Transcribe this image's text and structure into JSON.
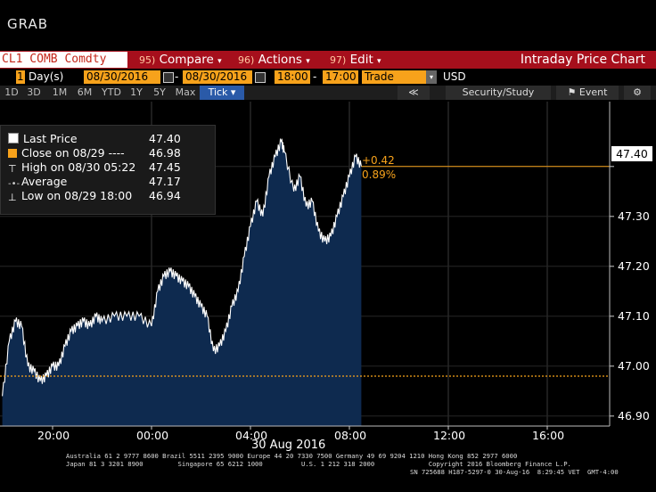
{
  "header": {
    "title": "GRAB"
  },
  "toolbar": {
    "ticker": "CL1 COMB Comdty",
    "buttons": [
      {
        "num": "95)",
        "label": "Compare",
        "arrow": "▾"
      },
      {
        "num": "96)",
        "label": "Actions",
        "arrow": "▾"
      },
      {
        "num": "97)",
        "label": "Edit",
        "arrow": "▾"
      }
    ],
    "chart_title": "Intraday Price Chart"
  },
  "range": {
    "days": "1",
    "days_unit": "Day(s)",
    "start_date": "08/30/2016",
    "dash": "-",
    "end_date": "08/30/2016",
    "start_time": "18:00",
    "end_time": "17:00",
    "field": "Trade",
    "currency": "USD"
  },
  "periods": [
    "1D",
    "3D",
    "1M",
    "6M",
    "YTD",
    "1Y",
    "5Y",
    "Max"
  ],
  "selected_period": "Tick ▾",
  "controls": {
    "back": "≪",
    "security": "Security/Study",
    "event": "Event",
    "settings_icon": "gear-icon"
  },
  "legend": [
    {
      "icon": "white-square",
      "label": "Last Price",
      "value": "47.40"
    },
    {
      "icon": "orange-square",
      "label": "Close on 08/29 ----",
      "value": "46.98"
    },
    {
      "icon": "high-marker",
      "label": "High on 08/30 05:22",
      "value": "47.45"
    },
    {
      "icon": "average-marker",
      "label": "Average",
      "value": "47.17"
    },
    {
      "icon": "low-marker",
      "label": "Low on 08/29 18:00",
      "value": "46.94"
    }
  ],
  "change": {
    "abs": "+0.42",
    "pct": "0.89%"
  },
  "last_price_label": "47.40",
  "date_label": "30 Aug 2016",
  "footer": {
    "line1": "Australia 61 2 9777 8600 Brazil 5511 2395 9000 Europe 44 20 7330 7500 Germany 49 69 9204 1210 Hong Kong 852 2977 6000",
    "line2": "Japan 81 3 3201 8900         Singapore 65 6212 1000          U.S. 1 212 318 2000              Copyright 2016 Bloomberg Finance L.P.",
    "line3": "SN 725688 H187-5297-0 30-Aug-16  8:29:45 VET  GMT-4:00"
  },
  "colors": {
    "toolbar": "#a60f1c",
    "accent": "#f7a21b",
    "area": "#0e2a4f",
    "line": "#ffffff"
  },
  "chart_data": {
    "type": "line",
    "series": [
      {
        "name": "Last Price",
        "x": [
          "17:58",
          "18:15",
          "18:30",
          "18:45",
          "19:00",
          "19:15",
          "19:30",
          "19:45",
          "20:00",
          "20:15",
          "20:30",
          "20:45",
          "21:00",
          "21:15",
          "21:30",
          "21:45",
          "22:00",
          "22:30",
          "23:00",
          "23:30",
          "00:00",
          "00:15",
          "00:30",
          "00:45",
          "01:00",
          "01:15",
          "01:30",
          "01:45",
          "02:00",
          "02:15",
          "02:30",
          "02:45",
          "03:00",
          "03:15",
          "03:30",
          "03:45",
          "04:00",
          "04:15",
          "04:30",
          "04:45",
          "05:00",
          "05:15",
          "05:22",
          "05:45",
          "06:00",
          "06:15",
          "06:30",
          "06:45",
          "07:00",
          "07:15",
          "07:30",
          "07:45",
          "08:00",
          "08:15",
          "08:29"
        ],
        "y": [
          46.94,
          47.05,
          47.09,
          47.08,
          47.0,
          46.99,
          46.97,
          46.98,
          47.0,
          47.0,
          47.04,
          47.07,
          47.08,
          47.09,
          47.08,
          47.1,
          47.09,
          47.1,
          47.1,
          47.1,
          47.08,
          47.15,
          47.18,
          47.19,
          47.18,
          47.17,
          47.16,
          47.14,
          47.12,
          47.1,
          47.03,
          47.04,
          47.07,
          47.12,
          47.15,
          47.22,
          47.28,
          47.33,
          47.3,
          47.38,
          47.42,
          47.45,
          47.43,
          47.35,
          47.38,
          47.32,
          47.33,
          47.27,
          47.25,
          47.26,
          47.3,
          47.34,
          47.38,
          47.42,
          47.4
        ]
      }
    ],
    "prev_close": 46.98,
    "last": 47.4,
    "x_ticks": [
      "20:00",
      "00:00",
      "04:00",
      "08:00",
      "12:00",
      "16:00"
    ],
    "x_range": [
      "17:58",
      "17:00"
    ],
    "xlabel": "30 Aug 2016",
    "y_ticks": [
      "46.90",
      "47.00",
      "47.10",
      "47.20",
      "47.30",
      "47.40"
    ],
    "ylim": [
      46.88,
      47.53
    ],
    "grid": true,
    "legend_position": "top-left"
  }
}
